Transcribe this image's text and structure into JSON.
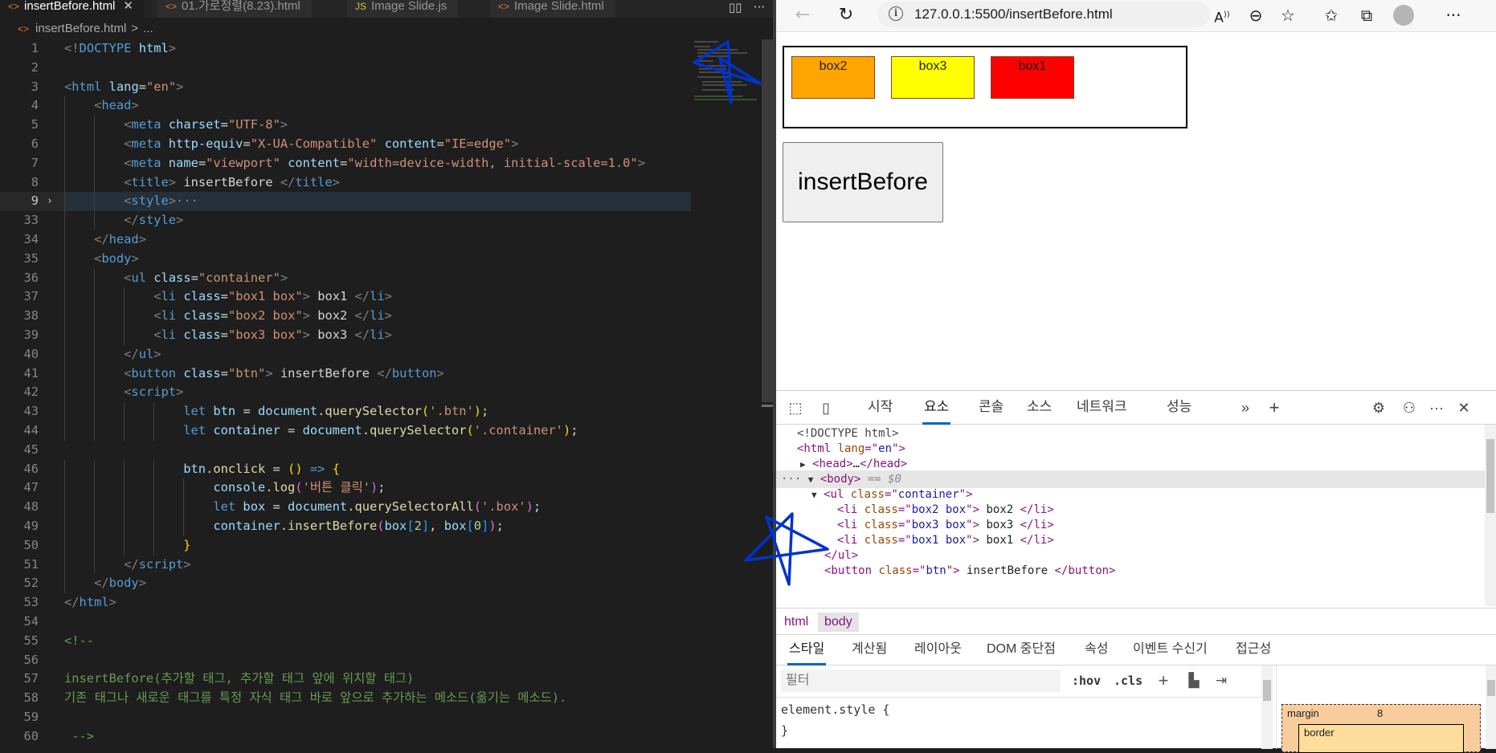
{
  "editor": {
    "tabs": [
      {
        "label": "insertBefore.html",
        "active": true
      },
      {
        "label": "01.가로정렬(8.23).html",
        "active": false
      },
      {
        "label": "Image Slide.js",
        "active": false
      },
      {
        "label": "Image Slide.html",
        "active": false
      }
    ],
    "breadcrumb": {
      "file": "insertBefore.html",
      "more": "..."
    },
    "line_numbers": [
      "1",
      "2",
      "3",
      "4",
      "5",
      "6",
      "7",
      "8",
      "9",
      "33",
      "34",
      "35",
      "36",
      "37",
      "38",
      "39",
      "40",
      "41",
      "42",
      "43",
      "44",
      "45",
      "46",
      "47",
      "48",
      "49",
      "50",
      "51",
      "52",
      "53",
      "54",
      "55",
      "56",
      "57",
      "58",
      "59",
      "60"
    ],
    "code": {
      "doctype": "html",
      "lang": "en",
      "charset": "UTF-8",
      "http_equiv": "X-UA-Compatible",
      "http_equiv_content": "IE=edge",
      "viewport_name": "viewport",
      "viewport_content": "width=device-width, initial-scale=1.0",
      "title_text": " insertBefore ",
      "fold_marker": "···",
      "ul_class": "container",
      "li1_class": "box1 box",
      "li1_text": " box1 ",
      "li2_class": "box2 box",
      "li2_text": " box2 ",
      "li3_class": "box3 box",
      "li3_text": " box3 ",
      "button_class": "btn",
      "button_text": " insertBefore ",
      "sel_btn": "'.btn'",
      "sel_container": "'.container'",
      "log_msg": "'버튼 클릭'",
      "sel_box": "'.box'",
      "idx2": "2",
      "idx0": "0",
      "comment_line1": "insertBefore(추가할 태그, 추가할 태그 앞에 위치할 태그)",
      "comment_line2": "기존 태그나 새로운 태그를 특정 자식 태그 바로 앞으로 추가하는 메소드(옮기는 메소드).",
      "comment_open": "<!--",
      "comment_close": " -->"
    }
  },
  "browser": {
    "url": "127.0.0.1:5500/insertBefore.html",
    "boxes": [
      {
        "label": "box2",
        "color": "#ffa500"
      },
      {
        "label": "box3",
        "color": "#ffff00"
      },
      {
        "label": "box1",
        "color": "#ff0000"
      }
    ],
    "button_label": "insertBefore"
  },
  "devtools": {
    "tabs": [
      "시작",
      "요소",
      "콘솔",
      "소스",
      "네트워크",
      "성능"
    ],
    "active_tab": "요소",
    "dom": {
      "doctype": "<!DOCTYPE html>",
      "html_lang": "en",
      "head_collapsed": "…",
      "body_marker": "== $0",
      "ul_class": "container",
      "li_items": [
        {
          "class": "box2 box",
          "text": " box2 "
        },
        {
          "class": "box3 box",
          "text": " box3 "
        },
        {
          "class": "box1 box",
          "text": " box1 "
        }
      ],
      "button_class": "btn",
      "button_text": " insertBefore "
    },
    "crumbs": [
      "html",
      "body"
    ],
    "panel_tabs": [
      "스타일",
      "계산됨",
      "레이아웃",
      "DOM 중단점",
      "속성",
      "이벤트 수신기",
      "접근성"
    ],
    "filter_placeholder": "필터",
    "hov": ":hov",
    "cls": ".cls",
    "element_style": "element.style {",
    "element_style_close": "}",
    "box_model": {
      "margin_label": "margin",
      "margin_value": "8",
      "border_label": "border"
    }
  },
  "colors": {
    "accent": "#0067c0",
    "star": "#0033cc"
  }
}
